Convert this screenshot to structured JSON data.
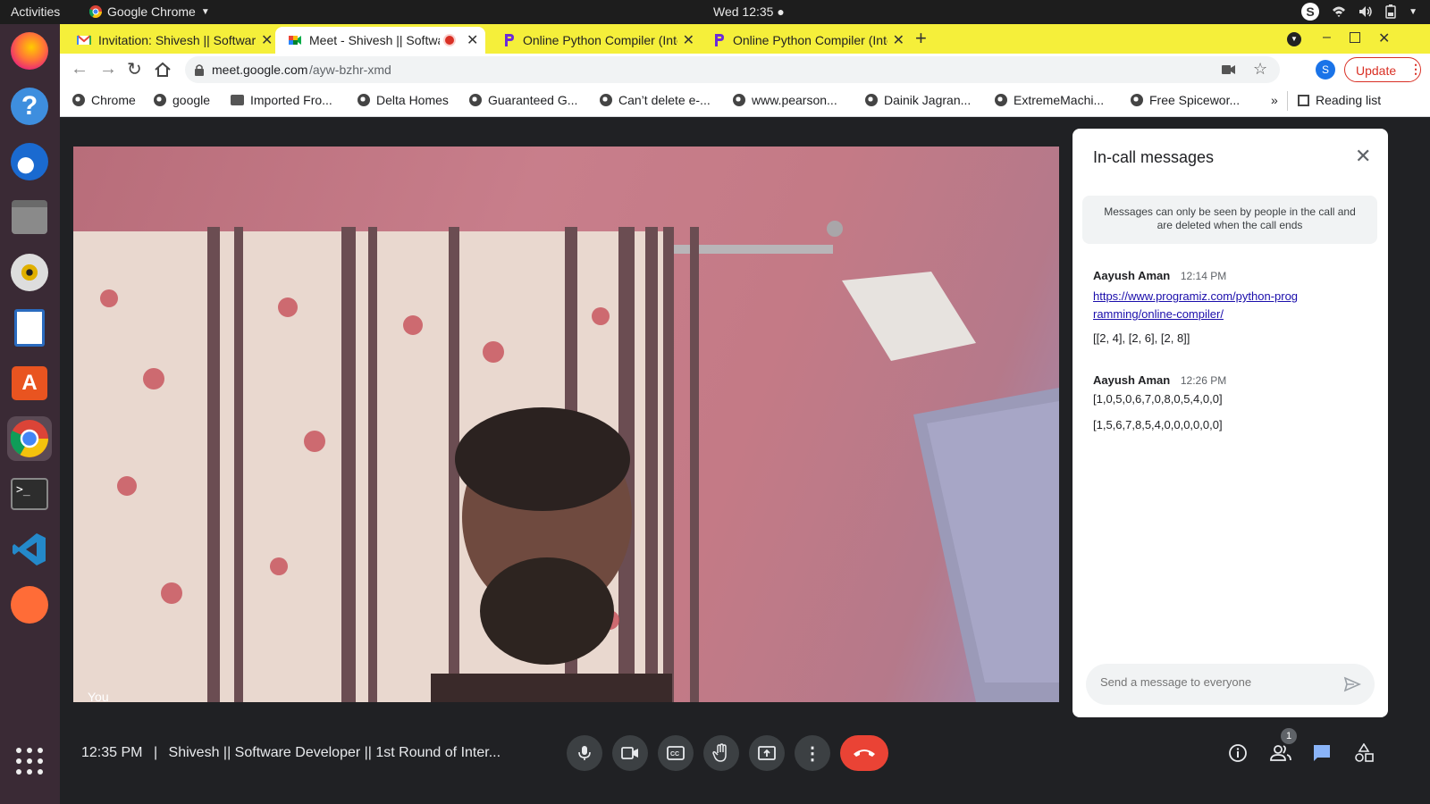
{
  "os": {
    "activities": "Activities",
    "app_name": "Google Chrome",
    "clock": "Wed 12:35 ●"
  },
  "browser": {
    "tabs": [
      {
        "title": "Invitation: Shivesh || Software",
        "icon": "gmail-icon"
      },
      {
        "title": "Meet - Shivesh || Software",
        "icon": "meet-icon"
      },
      {
        "title": "Online Python Compiler (Interp",
        "icon": "programiz-icon"
      },
      {
        "title": "Online Python Compiler (Interp",
        "icon": "programiz-icon"
      }
    ],
    "url_host": "meet.google.com",
    "url_path": "/ayw-bzhr-xmd",
    "profile_initial": "S",
    "update_label": "Update",
    "bookmarks": [
      "Chrome",
      "google",
      "Imported Fro...",
      "Delta Homes",
      "Guaranteed G...",
      "Can’t delete e-...",
      "www.pearson...",
      "Dainik Jagran...",
      "ExtremeMachi...",
      "Free Spicewor..."
    ],
    "reading_list": "Reading list",
    "more_bookmarks": "»"
  },
  "meet": {
    "self_label": "You",
    "time": "12:35 PM",
    "separator": "|",
    "meeting_title": "Shivesh || Software Developer || 1st Round of Inter...",
    "people_count": "1",
    "end_call_color": "#ea4335"
  },
  "chat": {
    "title": "In-call messages",
    "notice": "Messages can only be seen by people in the call and are deleted when the call ends",
    "messages": [
      {
        "sender": "Aayush Aman",
        "time": "12:14 PM",
        "link": "https://www.programiz.com/python-programming/online-compiler/",
        "lines": [
          "[[2, 4], [2, 6], [2, 8]]"
        ]
      },
      {
        "sender": "Aayush Aman",
        "time": "12:26 PM",
        "lines": [
          "[1,0,5,0,6,7,0,8,0,5,4,0,0]",
          "[1,5,6,7,8,5,4,0,0,0,0,0,0]"
        ]
      }
    ],
    "input_placeholder": "Send a message to everyone"
  }
}
